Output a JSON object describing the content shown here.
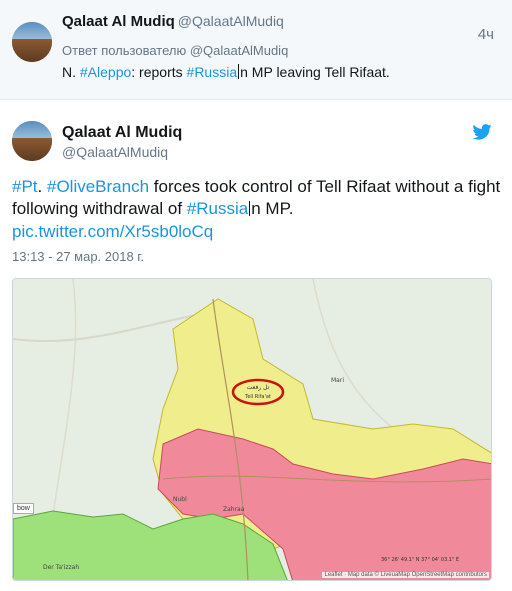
{
  "reply_tweet": {
    "author_name": "Qalaat Al Mudiq",
    "author_handle": "@QalaatAlMudiq",
    "time": "4ч",
    "reply_to": "Ответ пользователю @QalaatAlMudiq",
    "text_prefix": "N. ",
    "tag1": "#Aleppo",
    "text_mid": ": reports ",
    "tag2": "#Russia",
    "text_suffix": "n MP leaving Tell Rifaat."
  },
  "main_tweet": {
    "author_name": "Qalaat Al Mudiq",
    "author_handle": "@QalaatAlMudiq",
    "tag_pt": "#Pt",
    "text_dot": ". ",
    "tag_olive": "#OliveBranch",
    "text_part1": " forces took control of Tell Rifaat without a fight following withdrawal of ",
    "tag_russia": "#Russia",
    "text_part2": "n MP.",
    "link": "pic.twitter.com/Xr5sb0loCq",
    "date": "13:13 - 27 мар. 2018 г."
  },
  "map": {
    "label_tell_rifaat": "تل رفعت",
    "label_tell_rifaat_en": "Tell Rifa'at",
    "label_nubl": "Nubl",
    "label_zahraa": "Zahraa",
    "label_deir": "Der Ta'izzah",
    "label_mari": "Mari",
    "label_arrow_row": "bow",
    "attribution": "Leaflet · Map data © LiveuaMap OpenStreetMap contributors",
    "coords": "36° 26' 49.1\" N 37° 04' 03.1\" E",
    "colors": {
      "yellow": "#f0ee8c",
      "red": "#f08a9a",
      "green": "#9ee07a",
      "ring": "#cc1111"
    }
  },
  "colors": {
    "link": "#1b95e0",
    "muted": "#657786",
    "reply_bg": "#f5f8fa"
  }
}
